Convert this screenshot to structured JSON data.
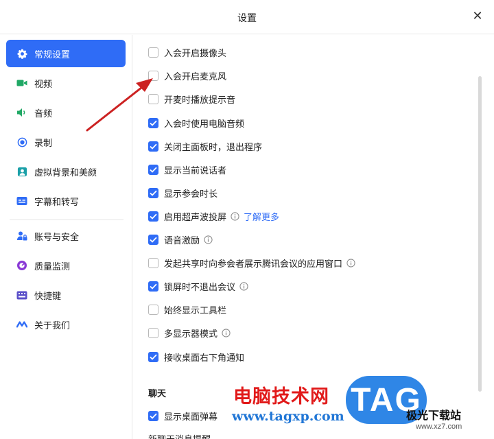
{
  "window": {
    "title": "设置",
    "close_glyph": "✕"
  },
  "sidebar": {
    "items": [
      {
        "label": "常规设置",
        "icon": "gear-icon",
        "active": true
      },
      {
        "label": "视频",
        "icon": "video-camera-icon"
      },
      {
        "label": "音频",
        "icon": "speaker-icon"
      },
      {
        "label": "录制",
        "icon": "record-icon"
      },
      {
        "label": "虚拟背景和美颜",
        "icon": "portrait-icon"
      },
      {
        "label": "字幕和转写",
        "icon": "caption-icon"
      },
      {
        "label": "账号与安全",
        "icon": "account-lock-icon"
      },
      {
        "label": "质量监测",
        "icon": "quality-gauge-icon"
      },
      {
        "label": "快捷键",
        "icon": "keyboard-icon"
      },
      {
        "label": "关于我们",
        "icon": "tencent-meeting-logo-icon"
      }
    ]
  },
  "options": [
    {
      "label": "入会开启摄像头",
      "checked": false
    },
    {
      "label": "入会开启麦克风",
      "checked": false
    },
    {
      "label": "开麦时播放提示音",
      "checked": false
    },
    {
      "label": "入会时使用电脑音频",
      "checked": true
    },
    {
      "label": "关闭主面板时，退出程序",
      "checked": true
    },
    {
      "label": "显示当前说话者",
      "checked": true
    },
    {
      "label": "显示参会时长",
      "checked": true
    },
    {
      "label": "启用超声波投屏",
      "checked": true,
      "info": true,
      "link": "了解更多"
    },
    {
      "label": "语音激励",
      "checked": true,
      "info": true
    },
    {
      "label": "发起共享时向参会者展示腾讯会议的应用窗口",
      "checked": false,
      "info": true
    },
    {
      "label": "锁屏时不退出会议",
      "checked": true,
      "info": true
    },
    {
      "label": "始终显示工具栏",
      "checked": false
    },
    {
      "label": "多显示器模式",
      "checked": false,
      "info": true
    },
    {
      "label": "接收桌面右下角通知",
      "checked": true
    }
  ],
  "chat": {
    "section_title": "聊天",
    "options": [
      {
        "label": "显示桌面弹幕",
        "checked": true
      },
      {
        "label": "新聊天消息提醒",
        "checked": false
      }
    ]
  },
  "watermark": {
    "site_name": "电脑技术网",
    "site_url": "www.tagxp.com",
    "logo_text": "TAG",
    "partner_name": "极光下载站",
    "partner_url": "www.xz7.com"
  },
  "colors": {
    "accent": "#2f6cf6",
    "arrow": "#cc2222",
    "watermark_red": "#e11a1a",
    "watermark_blue": "#2277d6"
  }
}
